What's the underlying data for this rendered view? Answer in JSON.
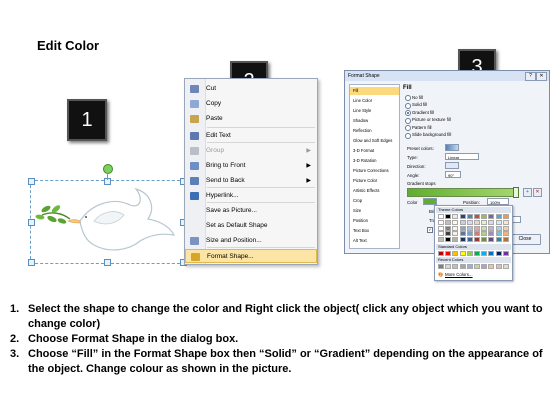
{
  "title": "Edit Color",
  "badges": [
    "1",
    "2",
    "3"
  ],
  "context_menu": {
    "items": [
      {
        "label": "Cut",
        "icon": "scissors-icon",
        "color": "#6f86b8",
        "disabled": false,
        "submenu": false
      },
      {
        "label": "Copy",
        "icon": "copy-icon",
        "color": "#8ea9d4",
        "disabled": false,
        "submenu": false
      },
      {
        "label": "Paste",
        "icon": "paste-icon",
        "color": "#c9a44e",
        "disabled": false,
        "submenu": false
      },
      {
        "label": "Edit Text",
        "icon": "edit-text-icon",
        "color": "#5c7ab0",
        "disabled": false,
        "submenu": false
      },
      {
        "label": "Group",
        "icon": "group-icon",
        "color": "#b9bec7",
        "disabled": true,
        "submenu": true
      },
      {
        "label": "Bring to Front",
        "icon": "bring-to-front-icon",
        "color": "#6b8fc6",
        "disabled": false,
        "submenu": true
      },
      {
        "label": "Send to Back",
        "icon": "send-to-back-icon",
        "color": "#5a7fb9",
        "disabled": false,
        "submenu": true
      },
      {
        "label": "Hyperlink...",
        "icon": "hyperlink-icon",
        "color": "#3a6fb5",
        "disabled": false,
        "submenu": false
      },
      {
        "label": "Save as Picture...",
        "icon": "",
        "color": "",
        "disabled": false,
        "submenu": false
      },
      {
        "label": "Set as Default Shape",
        "icon": "",
        "color": "",
        "disabled": false,
        "submenu": false
      },
      {
        "label": "Size and Position...",
        "icon": "size-position-icon",
        "color": "#7b93bf",
        "disabled": false,
        "submenu": false
      },
      {
        "label": "Format Shape...",
        "icon": "format-shape-icon",
        "color": "#d6a62c",
        "disabled": false,
        "submenu": false,
        "highlighted": true
      }
    ]
  },
  "dialog": {
    "title": "Format Shape",
    "categories": [
      "Fill",
      "Line Color",
      "Line Style",
      "Shadow",
      "Reflection",
      "Glow and Soft Edges",
      "3-D Format",
      "3-D Rotation",
      "Picture Corrections",
      "Picture Color",
      "Artistic Effects",
      "Crop",
      "Size",
      "Position",
      "Text Box",
      "Alt Text"
    ],
    "selected_category": "Fill",
    "fill_heading": "Fill",
    "fill_options": [
      "No fill",
      "Solid fill",
      "Gradient fill",
      "Picture or texture fill",
      "Pattern fill",
      "Slide background fill"
    ],
    "fill_selected": "Gradient fill",
    "preset_colors_label": "Preset colors:",
    "type_label": "Type:",
    "type_value": "Linear",
    "direction_label": "Direction:",
    "angle_label": "Angle:",
    "angle_value": "90°",
    "gradient_stops_label": "Gradient stops",
    "color_label": "Color",
    "position_label": "Position:",
    "position_value": "100%",
    "brightness_label": "Brightness:",
    "transparency_label": "Transparency:",
    "transparency_value": "0%",
    "rotate_label": "Rotate with shape",
    "close_label": "Close",
    "palette": {
      "theme_header": "Theme Colors",
      "standard_header": "Standard Colors",
      "recent_header": "Recent Colors",
      "more_label": "More Colors...",
      "theme_colors": [
        "#ffffff",
        "#000000",
        "#eeece1",
        "#1f497d",
        "#4f81bd",
        "#c0504d",
        "#9bbb59",
        "#8064a2",
        "#4bacc6",
        "#f79646"
      ],
      "standard_colors": [
        "#c00000",
        "#ff0000",
        "#ffc000",
        "#ffff00",
        "#92d050",
        "#00b050",
        "#00b0f0",
        "#0070c0",
        "#002060",
        "#7030a0"
      ],
      "recent_colors": [
        "#7f7f7f",
        "#d9d9d9",
        "#bfbfbf",
        "#a6a6a6",
        "#8eb4e3",
        "#c4d79b",
        "#b3a2c7",
        "#fac090",
        "#e6b9b8",
        "#d7e4bd"
      ]
    }
  },
  "steps": [
    {
      "num": "1.",
      "text": "Select the shape to change the color and Right click the object( click any object which you want to change color)"
    },
    {
      "num": "2.",
      "text": "Choose Format Shape in the dialog box."
    },
    {
      "num": "3.",
      "text": "Choose “Fill” in the Format Shape box then “Solid” or “Gradient” depending on the appearance of the object. Change colour as shown in the picture."
    }
  ]
}
